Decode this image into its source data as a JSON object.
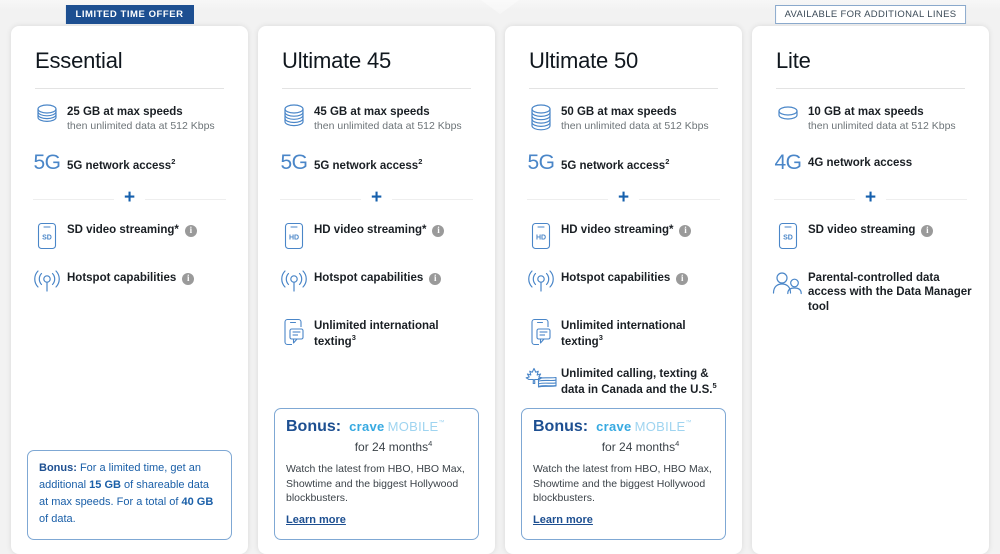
{
  "colors": {
    "page_bg": "#f2f2f2",
    "card_bg": "#ffffff",
    "brand_blue": "#1d4f91",
    "accent_blue": "#1660ad",
    "icon_blue": "#4a86c8",
    "crave_blue": "#36a9e1",
    "crave_light": "#9fd4f0",
    "info_gray": "#9a9a9a",
    "subtext_gray": "#6d7478"
  },
  "plans": [
    {
      "id": "essential",
      "name": "Essential",
      "badge": {
        "text": "LIMITED TIME OFFER",
        "style": "filled"
      },
      "data": {
        "icon": "data-cylinder-icon",
        "title": "25 GB at max speeds",
        "subtitle": "then unlimited data at 512 Kbps"
      },
      "network": {
        "glyph": "5G",
        "label": "5G network access",
        "footnote": "2"
      },
      "features": [
        {
          "icon": "phone-sd-icon",
          "badge": "SD",
          "label": "SD video streaming*",
          "info": true
        },
        {
          "icon": "hotspot-icon",
          "label": "Hotspot capabilities",
          "info": true
        }
      ],
      "bonus": {
        "type": "text",
        "label": "Bonus:",
        "segments": [
          {
            "t": "For a limited time, get an additional ",
            "b": false
          },
          {
            "t": "15 GB",
            "b": true
          },
          {
            "t": " of shareable data at max speeds. For a total of ",
            "b": false
          },
          {
            "t": "40 GB",
            "b": true
          },
          {
            "t": " of data.",
            "b": false
          }
        ]
      }
    },
    {
      "id": "ultimate-45",
      "name": "Ultimate 45",
      "badge": null,
      "data": {
        "icon": "data-cylinder-icon",
        "title": "45 GB at max speeds",
        "subtitle": "then unlimited data at 512 Kbps"
      },
      "network": {
        "glyph": "5G",
        "label": "5G network access",
        "footnote": "2"
      },
      "features": [
        {
          "icon": "phone-hd-icon",
          "badge": "HD",
          "label": "HD video streaming*",
          "info": true
        },
        {
          "icon": "hotspot-icon",
          "label": "Hotspot capabilities",
          "info": true
        },
        {
          "icon": "international-texting-icon",
          "label": "Unlimited international texting",
          "footnote": "3"
        }
      ],
      "bonus": {
        "type": "crave",
        "label": "Bonus:",
        "logo_primary": "crave",
        "logo_secondary": "MOBILE",
        "duration": "for 24 months",
        "duration_footnote": "4",
        "description": "Watch the latest from HBO, HBO Max, Showtime and the biggest Hollywood blockbusters.",
        "link": "Learn more"
      }
    },
    {
      "id": "ultimate-50",
      "name": "Ultimate 50",
      "badge": null,
      "data": {
        "icon": "data-cylinder-icon",
        "title": "50 GB at max speeds",
        "subtitle": "then unlimited data at 512 Kbps"
      },
      "network": {
        "glyph": "5G",
        "label": "5G network access",
        "footnote": "2"
      },
      "features": [
        {
          "icon": "phone-hd-icon",
          "badge": "HD",
          "label": "HD video streaming*",
          "info": true
        },
        {
          "icon": "hotspot-icon",
          "label": "Hotspot capabilities",
          "info": true
        },
        {
          "icon": "international-texting-icon",
          "label": "Unlimited international texting",
          "footnote": "3"
        },
        {
          "icon": "canada-usa-flag-icon",
          "label": "Unlimited calling, texting & data in Canada and the U.S.",
          "footnote": "5"
        }
      ],
      "bonus": {
        "type": "crave",
        "label": "Bonus:",
        "logo_primary": "crave",
        "logo_secondary": "MOBILE",
        "duration": "for 24 months",
        "duration_footnote": "4",
        "description": "Watch the latest from HBO, HBO Max, Showtime and the biggest Hollywood blockbusters.",
        "link": "Learn more"
      }
    },
    {
      "id": "lite",
      "name": "Lite",
      "badge": {
        "text": "AVAILABLE FOR ADDITIONAL LINES",
        "style": "outline"
      },
      "data": {
        "icon": "data-disc-icon",
        "title": "10 GB at max speeds",
        "subtitle": "then unlimited data at 512 Kbps"
      },
      "network": {
        "glyph": "4G",
        "label": "4G network access",
        "footnote": ""
      },
      "features": [
        {
          "icon": "phone-sd-icon",
          "badge": "SD",
          "label": "SD video streaming",
          "info": true
        },
        {
          "icon": "parental-control-icon",
          "label": "Parental-controlled data access with the Data Manager tool"
        }
      ],
      "bonus": null
    }
  ]
}
